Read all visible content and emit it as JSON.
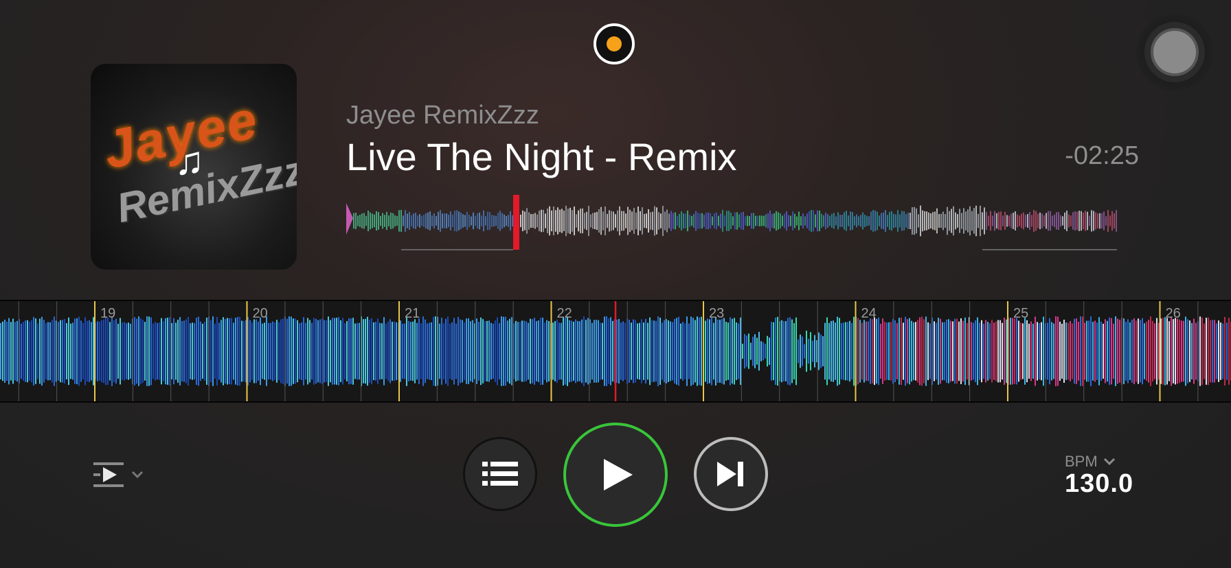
{
  "track": {
    "artist": "Jayee RemixZzz",
    "title": "Live The Night - Remix",
    "remaining_time": "-02:25",
    "album_art_text_line1": "Jayee",
    "album_art_text_line2": "RemixZzz"
  },
  "waveform": {
    "beat_numbers": [
      "19",
      "20",
      "21",
      "22",
      "23",
      "24",
      "25",
      "26"
    ]
  },
  "tempo": {
    "bpm_label": "BPM",
    "bpm_value": "130.0"
  },
  "icons": {
    "record": "record-indicator-icon",
    "knob": "settings-knob-icon",
    "mode": "play-mode-icon",
    "playlist": "playlist-icon",
    "play": "play-icon",
    "next": "skip-next-icon",
    "chevron": "chevron-down-icon"
  },
  "colors": {
    "accent_play": "#39c53a",
    "record_dot": "#f5a21a",
    "cue_marker": "#e21a2a",
    "beat_marker": "#e8c84a"
  }
}
